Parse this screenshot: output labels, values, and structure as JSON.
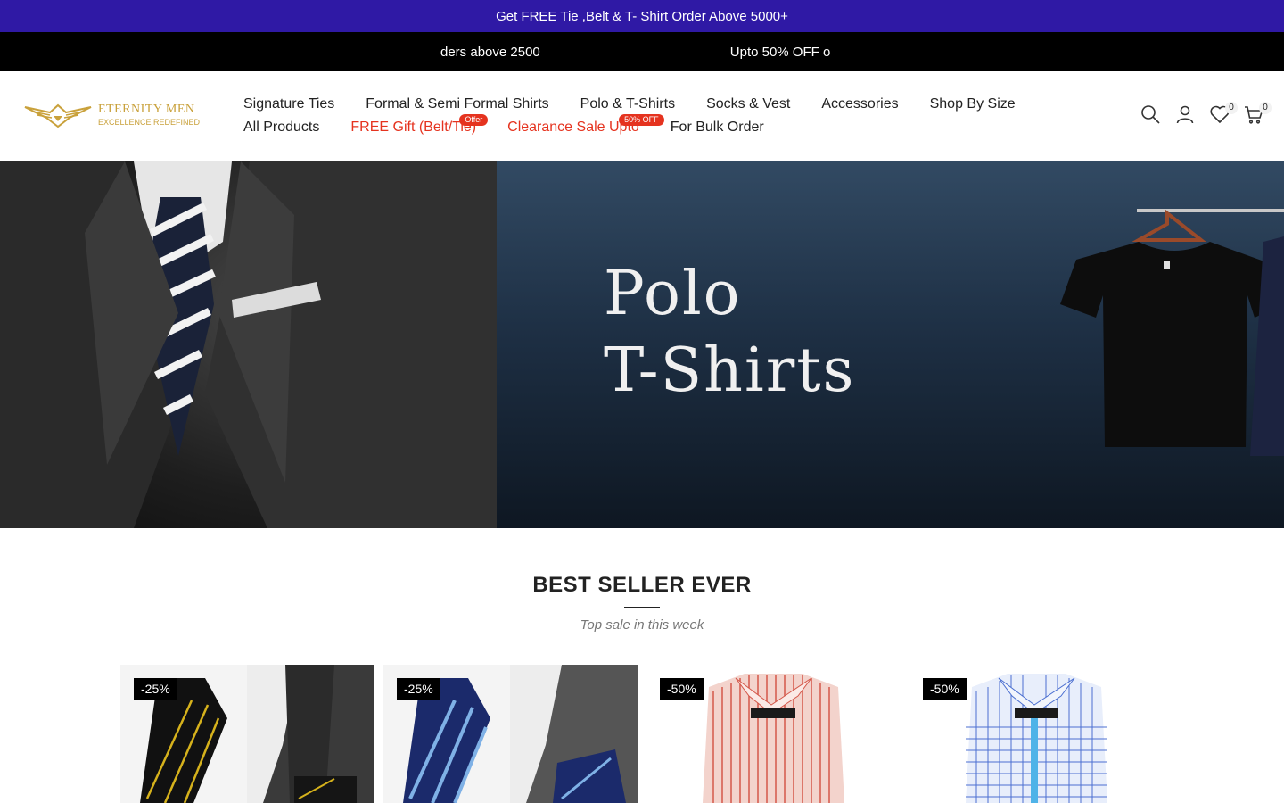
{
  "promo": {
    "text": "Get FREE Tie ,Belt & T- Shirt Order Above 5000+"
  },
  "marquee": {
    "items": [
      "ders above 2500",
      "Upto 50% OFF o"
    ]
  },
  "brand": {
    "name": "ETERNITY MEN",
    "tagline": "EXCELLENCE REDEFINED",
    "color": "#c9a13b"
  },
  "nav": {
    "row1": [
      "Signature Ties",
      "Formal & Semi Formal Shirts",
      "Polo & T-Shirts",
      "Socks & Vest",
      "Accessories",
      "Shop By Size"
    ],
    "row2": [
      "All Products",
      "FREE Gift (Belt/Tie)",
      "Clearance Sale Upto",
      "For Bulk Order"
    ],
    "badges": {
      "gift": "Offer",
      "clearance": "50% OFF"
    }
  },
  "header_icons": {
    "search": "search-icon",
    "account": "user-icon",
    "wishlist_count": "0",
    "cart_count": "0"
  },
  "hero": {
    "line1": "Polo",
    "line2": "T-Shirts"
  },
  "section": {
    "title": "BEST SELLER EVER",
    "subtitle": "Top sale in this week"
  },
  "products": [
    {
      "discount": "-25%"
    },
    {
      "discount": "-25%"
    },
    {
      "discount": "-50%"
    },
    {
      "discount": "-50%"
    }
  ],
  "colors": {
    "promo_bg": "#2f19a5",
    "accent_red": "#e5331f"
  }
}
